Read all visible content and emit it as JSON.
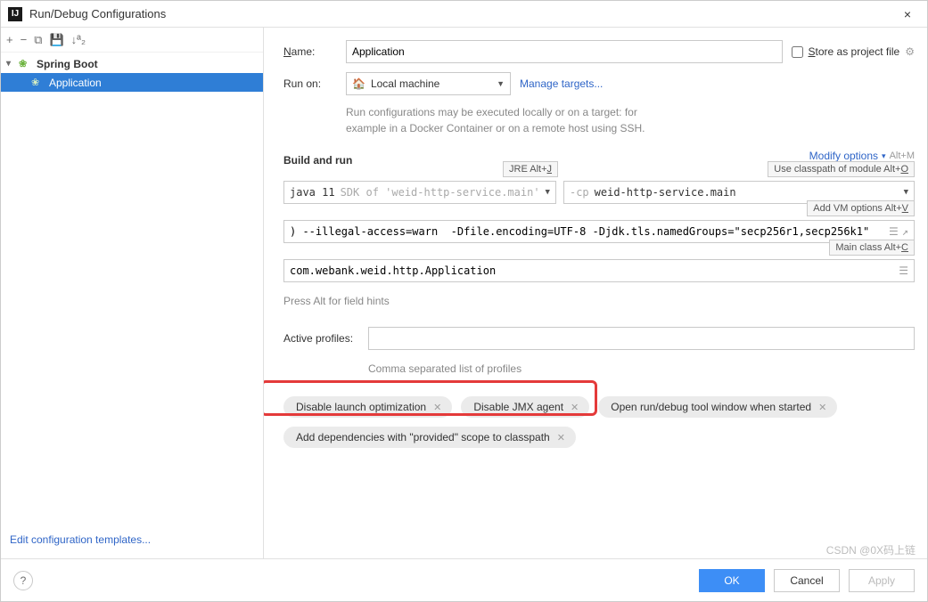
{
  "titlebar": {
    "title": "Run/Debug Configurations",
    "close": "×"
  },
  "toolbar": {
    "add": "+",
    "remove": "−",
    "copy": "⧉",
    "save": "💾",
    "sort": "↓ª₂"
  },
  "tree": {
    "root_label": "Spring Boot",
    "item_label": "Application"
  },
  "sidebar": {
    "edit_templates": "Edit configuration templates..."
  },
  "form": {
    "name_label": "Name:",
    "name_value": "Application",
    "store_label": "Store as project file",
    "runon_label": "Run on:",
    "runon_value": "Local machine",
    "manage_targets": "Manage targets...",
    "runon_info_l1": "Run configurations may be executed locally or on a target: for",
    "runon_info_l2": "example in a Docker Container or on a remote host using SSH."
  },
  "build": {
    "title": "Build and run",
    "modify_label": "Modify options",
    "modify_shortcut": "Alt+M",
    "jre_hint": "JRE Alt+J",
    "classpath_hint": "Use classpath of module Alt+O",
    "addvm_hint": "Add VM options Alt+V",
    "mainclass_hint": "Main class Alt+C",
    "sdk_name": "java 11",
    "sdk_detail": "SDK of 'weid-http-service.main'",
    "cp_prefix": "-cp",
    "cp_value": "weid-http-service.main",
    "vm_value": ") --illegal-access=warn  -Dfile.encoding=UTF-8 -Djdk.tls.namedGroups=\"secp256r1,secp256k1\"",
    "main_class": "com.webank.weid.http.Application",
    "field_hint": "Press Alt for field hints"
  },
  "profiles": {
    "label": "Active profiles:",
    "value": "",
    "hint": "Comma separated list of profiles"
  },
  "tags": {
    "t1": "Disable launch optimization",
    "t2": "Disable JMX agent",
    "t3": "Open run/debug tool window when started",
    "t4": "Add dependencies with \"provided\" scope to classpath"
  },
  "footer": {
    "ok": "OK",
    "cancel": "Cancel",
    "apply": "Apply"
  },
  "watermark": "CSDN @0X码上链"
}
